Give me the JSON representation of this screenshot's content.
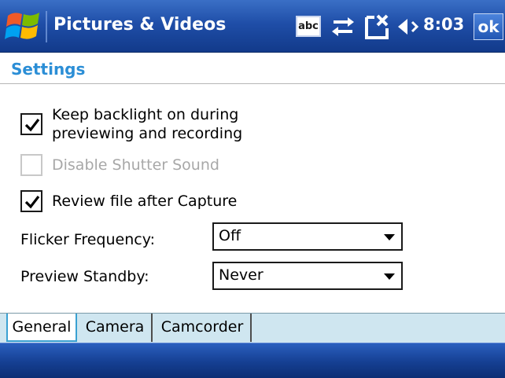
{
  "titlebar": {
    "app_title": "Pictures & Videos",
    "input_indicator": "abc",
    "time": "8:03",
    "ok_label": "ok"
  },
  "header": {
    "title": "Settings"
  },
  "options": {
    "backlight": {
      "label_line1": "Keep backlight on during",
      "label_line2": "previewing and recording",
      "checked": true,
      "enabled": true
    },
    "shutter_sound": {
      "label": "Disable Shutter Sound",
      "checked": false,
      "enabled": false
    },
    "review_file": {
      "label": "Review file after Capture",
      "checked": true,
      "enabled": true
    }
  },
  "fields": {
    "flicker": {
      "label": "Flicker Frequency:",
      "value": "Off"
    },
    "standby": {
      "label": "Preview Standby:",
      "value": "Never"
    }
  },
  "tabs": [
    {
      "label": "General",
      "active": true
    },
    {
      "label": "Camera",
      "active": false
    },
    {
      "label": "Camcorder",
      "active": false
    }
  ],
  "colors": {
    "title_accent": "#2b8ed6",
    "titlebar_blue": "#1f4ea8",
    "tab_background": "#cfe6f0"
  }
}
